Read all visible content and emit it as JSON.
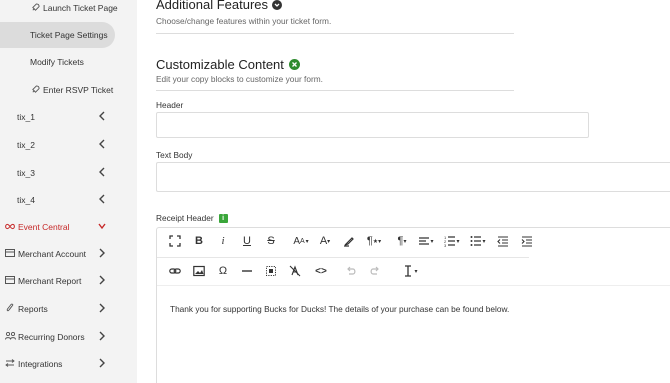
{
  "sidebar": {
    "items": [
      {
        "label": "Launch Ticket Page",
        "icon": "rocket-icon"
      },
      {
        "label": "Ticket Page Settings"
      },
      {
        "label": "Modify Tickets"
      },
      {
        "label": "Enter RSVP Ticket",
        "icon": "rocket-icon"
      },
      {
        "label": "tix_1"
      },
      {
        "label": "tix_2"
      },
      {
        "label": "tix_3"
      },
      {
        "label": "tix_4"
      },
      {
        "label": "Event Central",
        "icon": "infinity-icon"
      },
      {
        "label": "Merchant Account",
        "icon": "card-icon"
      },
      {
        "label": "Merchant Report",
        "icon": "card-icon"
      },
      {
        "label": "Reports",
        "icon": "paperclip-icon"
      },
      {
        "label": "Recurring Donors",
        "icon": "people-icon"
      },
      {
        "label": "Integrations",
        "icon": "arrows-icon"
      }
    ]
  },
  "main": {
    "additional": {
      "title": "Additional Features",
      "subtitle": "Choose/change features within your ticket form."
    },
    "customizable": {
      "title": "Customizable Content",
      "subtitle": "Edit your copy blocks to customize your form."
    },
    "fields": {
      "header_label": "Header",
      "header_value": "",
      "text_body_label": "Text Body",
      "text_body_value": "",
      "receipt_header_label": "Receipt Header"
    },
    "editor": {
      "content": "Thank you for supporting Bucks for Ducks! The details of your purchase can be found below."
    }
  },
  "colors": {
    "sidebar_bg": "#f3f3f3",
    "active_item_bg": "#dcdcdc",
    "event_central_red": "#c62828",
    "badge_green": "#2e8b2e"
  }
}
